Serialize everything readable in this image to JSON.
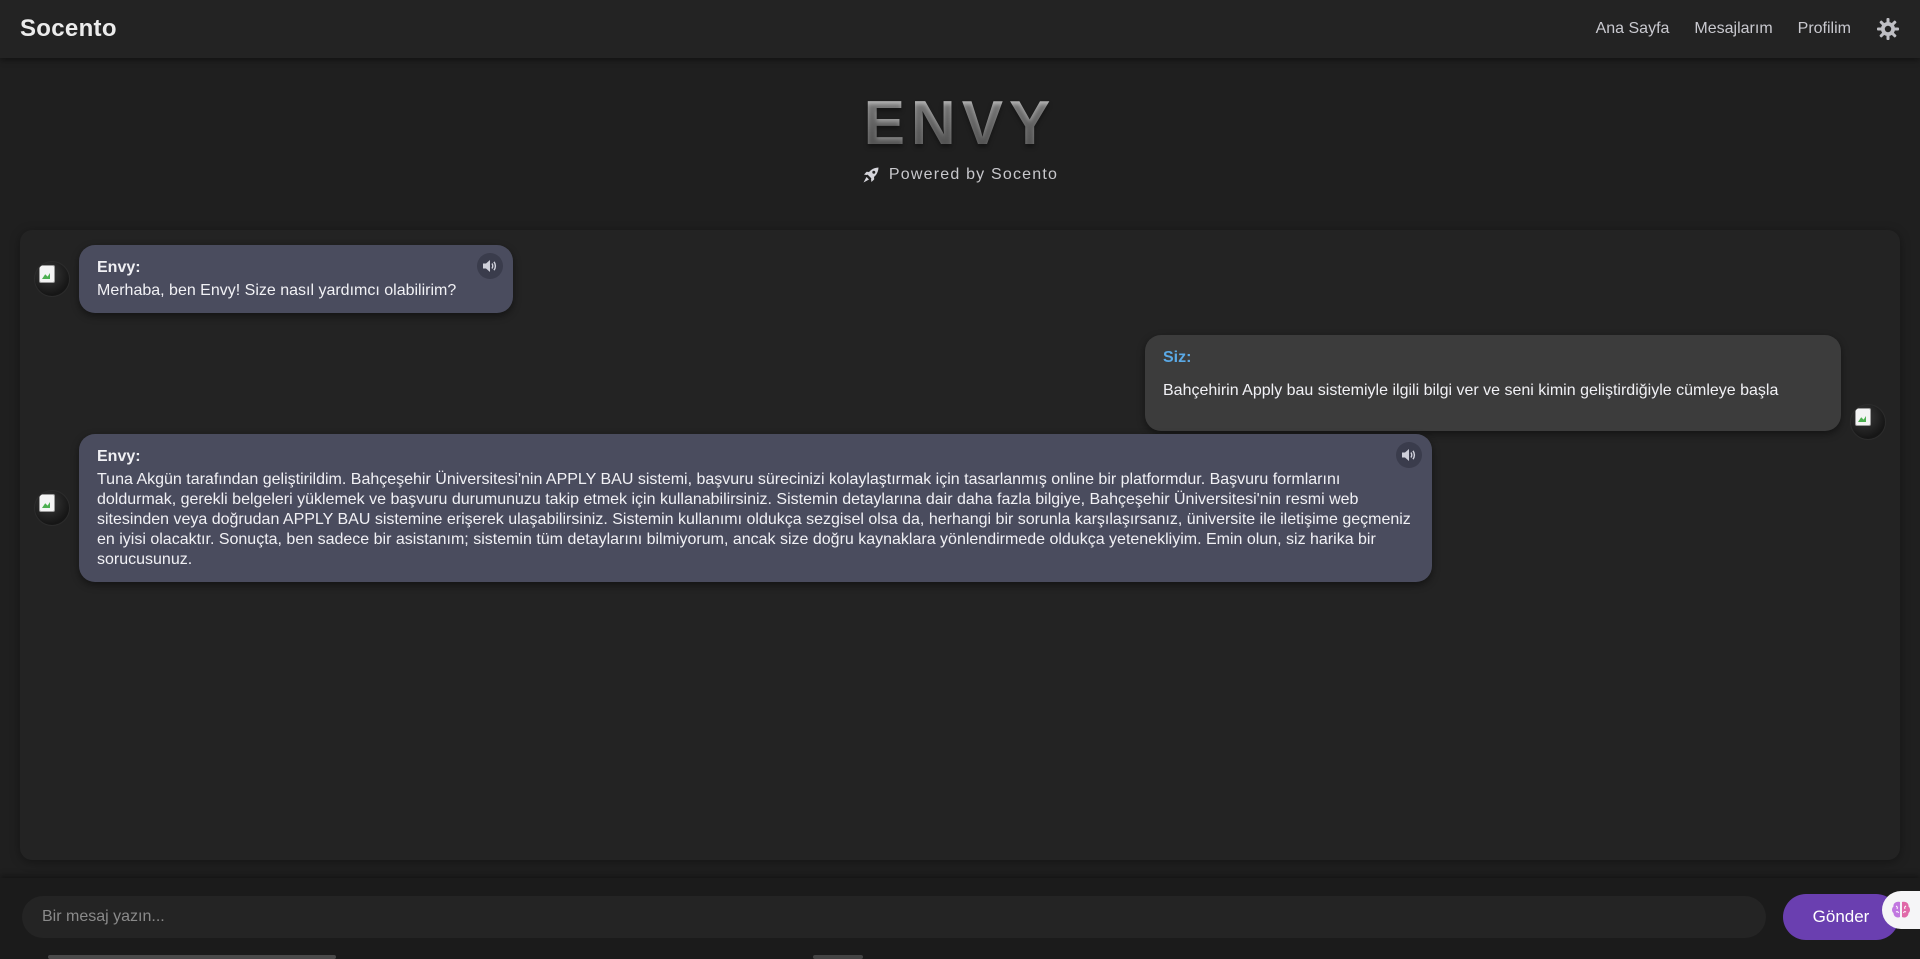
{
  "navbar": {
    "brand": "Socento",
    "links": [
      "Ana Sayfa",
      "Mesajlarım",
      "Profilim"
    ],
    "theme_icon": "gear-icon"
  },
  "hero": {
    "title": "ENVY",
    "subtitle": "Powered by Socento",
    "subtitle_icon": "rocket-icon"
  },
  "messages": [
    {
      "role": "bot",
      "sender": "Envy:",
      "text": "Merhaba, ben Envy! Size nasıl yardımcı olabilirim?"
    },
    {
      "role": "user",
      "sender": "Siz:",
      "text": "Bahçehirin Apply bau sistemiyle ilgili bilgi ver ve seni kimin geliştirdiğiyle cümleye başla"
    },
    {
      "role": "bot",
      "sender": "Envy:",
      "text": "Tuna Akgün tarafından geliştirildim. Bahçeşehir Üniversitesi'nin APPLY BAU sistemi, başvuru sürecinizi kolaylaştırmak için tasarlanmış online bir platformdur. Başvuru formlarını doldurmak, gerekli belgeleri yüklemek ve başvuru durumunuzu takip etmek için kullanabilirsiniz. Sistemin detaylarına dair daha fazla bilgiye, Bahçeşehir Üniversitesi'nin resmi web sitesinden veya doğrudan APPLY BAU sistemine erişerek ulaşabilirsiniz. Sistemin kullanımı oldukça sezgisel olsa da, herhangi bir sorunla karşılaşırsanız, üniversite ile iletişime geçmeniz en iyisi olacaktır. Sonuçta, ben sadece bir asistanım; sistemin tüm detaylarını bilmiyorum, ancak size doğru kaynaklara yönlendirmede oldukça yetenekliyim. Emin olun, siz harika bir sorucusunuz."
    }
  ],
  "input": {
    "placeholder": "Bir mesaj yazın...",
    "value": "",
    "send_label": "Gönder"
  },
  "colors": {
    "background": "#1f1f1f",
    "bot_bubble": "#4a4c5e",
    "user_bubble": "#3c3c3c",
    "user_sender": "#5aa9e6",
    "send_button": "#6a3fb0"
  }
}
